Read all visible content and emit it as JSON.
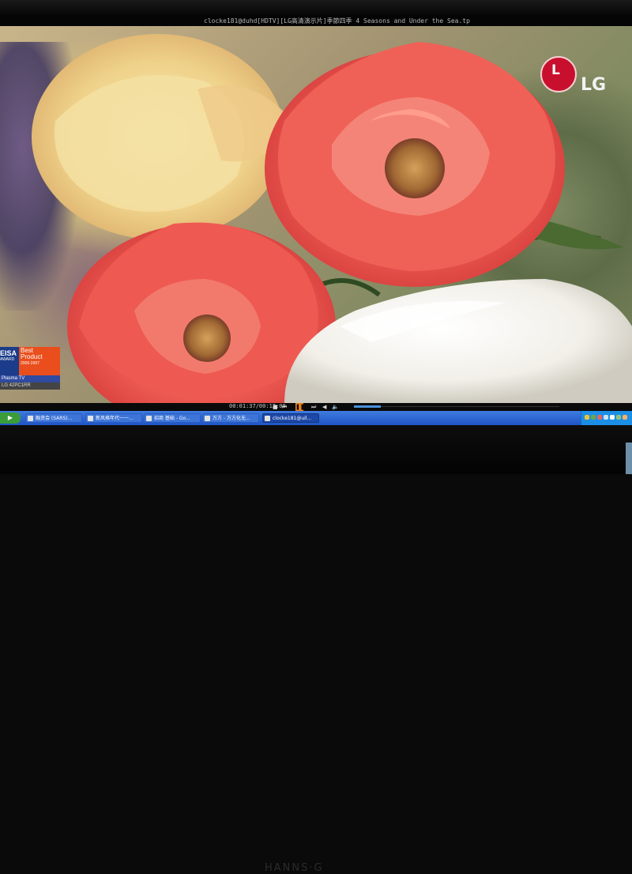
{
  "window": {
    "title": "clocke181@duhd[HDTV][LG高清演示片]季節四季 4 Seasons and Under the Sea.tp"
  },
  "video": {
    "watermark": {
      "logo_glyph": "L",
      "brand_text": "LG",
      "color": "#c8102e"
    },
    "award_badge": {
      "left_title": "EISA",
      "left_sub": "AWARD",
      "line1": "Best",
      "line2": "Product",
      "years": "2006-2007",
      "category": "Plasma TV",
      "model": "LG 42PC1RR"
    }
  },
  "controls": {
    "time_display": "00:01:37/00:12:00",
    "buttons": {
      "stop": "■",
      "prev": "⏮",
      "play_pause": "❚❚",
      "next": "⏭",
      "rewind": "◀",
      "volume": "🔈"
    },
    "progress_fraction": 0.13
  },
  "taskbar": {
    "tasks": [
      {
        "label": "融资会 (SARS)...",
        "active": false
      },
      {
        "label": "新风格年代一一...",
        "active": false
      },
      {
        "label": "招商 基础 - Go...",
        "active": false
      },
      {
        "label": "万方 - 万方化无...",
        "active": false
      },
      {
        "label": "clocke181@uil...",
        "active": true
      }
    ]
  },
  "monitor": {
    "brand": "HANNS·G"
  }
}
